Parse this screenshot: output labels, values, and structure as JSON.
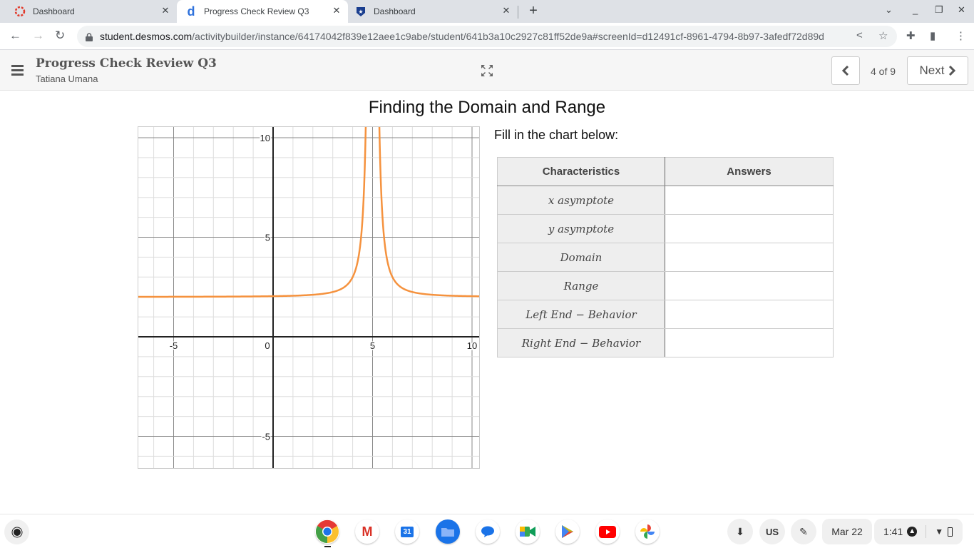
{
  "browser": {
    "tabs": [
      {
        "title": "Dashboard",
        "icon": "canvas-icon",
        "active": false
      },
      {
        "title": "Progress Check Review Q3",
        "icon": "desmos-icon",
        "active": true
      },
      {
        "title": "Dashboard",
        "icon": "shield-star-icon",
        "active": false
      }
    ],
    "url_host": "student.desmos.com",
    "url_path": "/activitybuilder/instance/64174042f839e12aee1c9abe/student/641b3a10c2927c81ff52de9a#screenId=d12491cf-8961-4794-8b97-3afedf72d89d"
  },
  "appbar": {
    "title": "Progress Check Review Q3",
    "student": "Tatiana Umana",
    "page_indicator": "4 of 9",
    "next_label": "Next"
  },
  "screen": {
    "title": "Finding the Domain and Range",
    "prompt": "Fill in the chart below:",
    "table": {
      "headers": [
        "Characteristics",
        "Answers"
      ],
      "rows": [
        {
          "characteristic": "x asymptote",
          "answer": ""
        },
        {
          "characteristic": "y asymptote",
          "answer": ""
        },
        {
          "characteristic": "Domain",
          "answer": ""
        },
        {
          "characteristic": "Range",
          "answer": ""
        },
        {
          "characteristic": "Left End − Behavior",
          "answer": ""
        },
        {
          "characteristic": "Right End − Behavior",
          "answer": ""
        }
      ]
    }
  },
  "chart_data": {
    "type": "line",
    "title": "",
    "xlabel": "",
    "ylabel": "",
    "xlim": [
      -6.8,
      10.4
    ],
    "ylim": [
      -6.6,
      10.5
    ],
    "x_ticks": [
      -5,
      0,
      5,
      10
    ],
    "y_ticks": [
      10,
      5,
      -5
    ],
    "grid": true,
    "minor_grid_step": 1,
    "major_grid_step": 5,
    "series": [
      {
        "name": "y = 1/(x-5)^2 + 2",
        "color": "#f5923e",
        "function": "1/(x-5)^2+2",
        "vertical_asymptote": 5,
        "horizontal_asymptote": 2,
        "points": [
          [
            -6.8,
            2.007
          ],
          [
            -5,
            2.01
          ],
          [
            0,
            2.04
          ],
          [
            2,
            2.11
          ],
          [
            3,
            2.25
          ],
          [
            4,
            3
          ],
          [
            4.5,
            6
          ],
          [
            4.7,
            13.1
          ],
          [
            5.3,
            13.1
          ],
          [
            5.5,
            6
          ],
          [
            6,
            3
          ],
          [
            7,
            2.25
          ],
          [
            8,
            2.11
          ],
          [
            10,
            2.04
          ],
          [
            10.4,
            2.034
          ]
        ]
      }
    ]
  },
  "shelf": {
    "apps": [
      "Chrome",
      "Gmail",
      "Calendar",
      "Files",
      "Messages",
      "Meet",
      "Play Store",
      "YouTube",
      "Photos"
    ],
    "calendar_day": "31",
    "ime": "US",
    "date": "Mar 22",
    "time": "1:41"
  }
}
